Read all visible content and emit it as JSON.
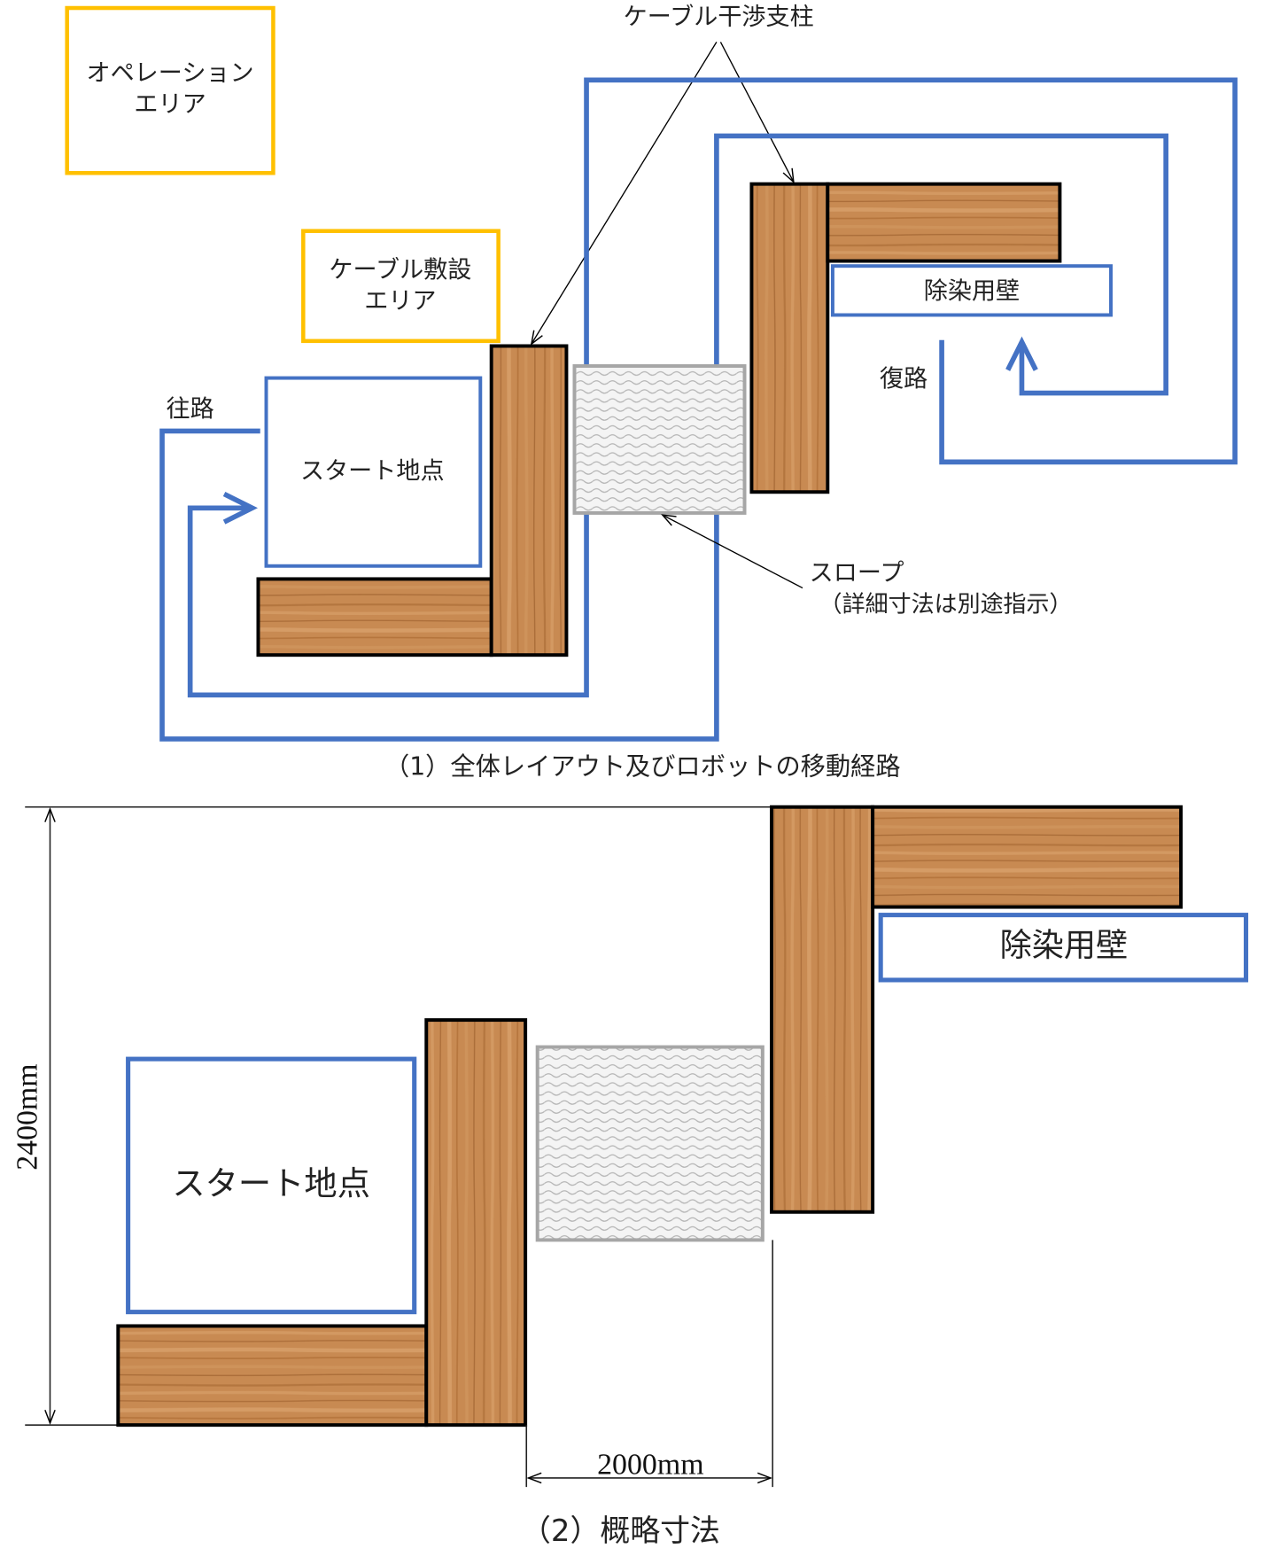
{
  "colors": {
    "route_blue": "#4472c4",
    "area_yellow": "#ffc000",
    "slope_gray": "#a6a6a6",
    "wood_base": "#c88a52",
    "outline_black": "#000000"
  },
  "section1": {
    "operation_area": {
      "line1": "オペレーション",
      "line2": "エリア"
    },
    "cable_laying_area": {
      "line1": "ケーブル敷設",
      "line2": "エリア"
    },
    "cable_post_label": "ケーブル干渉支柱",
    "start_label": "スタート地点",
    "decon_wall_label": "除染用壁",
    "outbound_label": "往路",
    "return_label": "復路",
    "slope_label": {
      "line1": "スロープ",
      "line2": "（詳細寸法は別途指示）"
    },
    "caption": "（1）全体レイアウト及びロボットの移動経路"
  },
  "section2": {
    "start_label": "スタート地点",
    "decon_wall_label": "除染用壁",
    "height_dimension": "2400mm",
    "width_dimension": "2000mm",
    "caption": "（2）概略寸法"
  }
}
